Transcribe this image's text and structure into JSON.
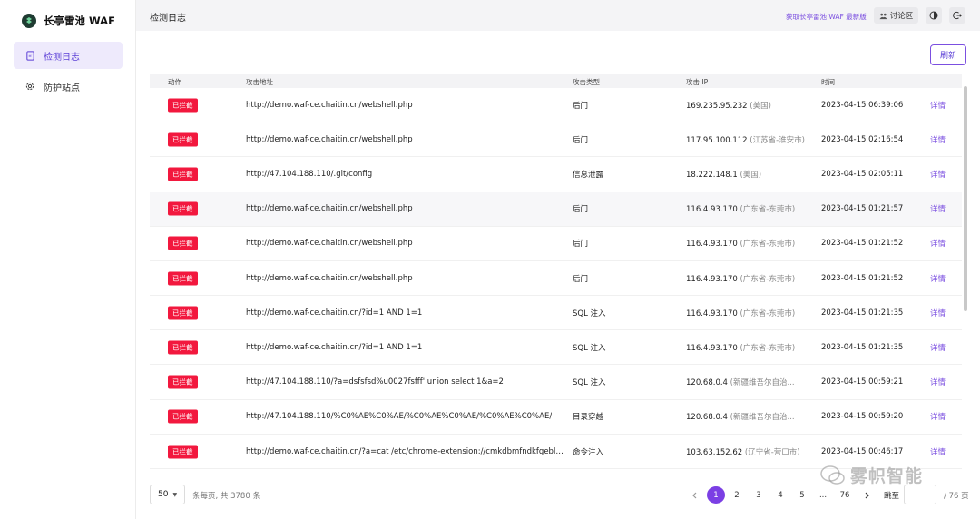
{
  "brand": {
    "name": "长亭雷池 WAF"
  },
  "sidebar": {
    "items": [
      {
        "label": "检测日志",
        "icon": "document-icon",
        "active": true
      },
      {
        "label": "防护站点",
        "icon": "gear-icon",
        "active": false
      }
    ]
  },
  "header": {
    "title": "检测日志",
    "get_latest": "获取长亭雷池 WAF 最新版",
    "forum_label": "讨论区"
  },
  "toolbar": {
    "refresh_label": "刷新"
  },
  "table": {
    "columns": [
      "动作",
      "攻击地址",
      "攻击类型",
      "攻击 IP",
      "时间"
    ],
    "rows": [
      {
        "action": "已拦截",
        "url": "http://demo.waf-ce.chaitin.cn/webshell.php",
        "type": "后门",
        "ip": "169.235.95.232",
        "location": "(美国)",
        "time": "2023-04-15 06:39:06",
        "detail": "详情"
      },
      {
        "action": "已拦截",
        "url": "http://demo.waf-ce.chaitin.cn/webshell.php",
        "type": "后门",
        "ip": "117.95.100.112",
        "location": "(江苏省-淮安市)",
        "time": "2023-04-15 02:16:54",
        "detail": "详情"
      },
      {
        "action": "已拦截",
        "url": "http://47.104.188.110/.git/config",
        "type": "信息泄露",
        "ip": "18.222.148.1",
        "location": "(美国)",
        "time": "2023-04-15 02:05:11",
        "detail": "详情"
      },
      {
        "action": "已拦截",
        "url": "http://demo.waf-ce.chaitin.cn/webshell.php",
        "type": "后门",
        "ip": "116.4.93.170",
        "location": "(广东省-东莞市)",
        "time": "2023-04-15 01:21:57",
        "detail": "详情"
      },
      {
        "action": "已拦截",
        "url": "http://demo.waf-ce.chaitin.cn/webshell.php",
        "type": "后门",
        "ip": "116.4.93.170",
        "location": "(广东省-东莞市)",
        "time": "2023-04-15 01:21:52",
        "detail": "详情"
      },
      {
        "action": "已拦截",
        "url": "http://demo.waf-ce.chaitin.cn/webshell.php",
        "type": "后门",
        "ip": "116.4.93.170",
        "location": "(广东省-东莞市)",
        "time": "2023-04-15 01:21:52",
        "detail": "详情"
      },
      {
        "action": "已拦截",
        "url": "http://demo.waf-ce.chaitin.cn/?id=1 AND 1=1",
        "type": "SQL 注入",
        "ip": "116.4.93.170",
        "location": "(广东省-东莞市)",
        "time": "2023-04-15 01:21:35",
        "detail": "详情"
      },
      {
        "action": "已拦截",
        "url": "http://demo.waf-ce.chaitin.cn/?id=1 AND 1=1",
        "type": "SQL 注入",
        "ip": "116.4.93.170",
        "location": "(广东省-东莞市)",
        "time": "2023-04-15 01:21:35",
        "detail": "详情"
      },
      {
        "action": "已拦截",
        "url": "http://47.104.188.110/?a=dsfsfsd%u0027fsfff' union select 1&a=2",
        "type": "SQL 注入",
        "ip": "120.68.0.4",
        "location": "(新疆维吾尔自治...",
        "time": "2023-04-15 00:59:21",
        "detail": "详情"
      },
      {
        "action": "已拦截",
        "url": "http://47.104.188.110/%C0%AE%C0%AE/%C0%AE%C0%AE/%C0%AE%C0%AE/",
        "type": "目录穿越",
        "ip": "120.68.0.4",
        "location": "(新疆维吾尔自治...",
        "time": "2023-04-15 00:59:20",
        "detail": "详情"
      },
      {
        "action": "已拦截",
        "url": "http://demo.waf-ce.chaitin.cn/?a=cat /etc/chrome-extension://cmkdbmfndkfgebldhnk...",
        "type": "命令注入",
        "ip": "103.63.152.62",
        "location": "(辽宁省-营口市)",
        "time": "2023-04-15 00:46:17",
        "detail": "详情"
      }
    ]
  },
  "pagination": {
    "page_size": "50",
    "total_text": "条每页, 共 3780 条",
    "pages": [
      "1",
      "2",
      "3",
      "4",
      "5",
      "...",
      "76"
    ],
    "current_page": "1",
    "jump_label": "跳至",
    "jump_value": "",
    "pages_total": "/ 76 页"
  },
  "watermark": {
    "text": "雾帜智能"
  },
  "colors": {
    "accent": "#7b3fe4",
    "blocked_badge": "#f2183e",
    "active_nav_bg": "#eeeafc"
  }
}
